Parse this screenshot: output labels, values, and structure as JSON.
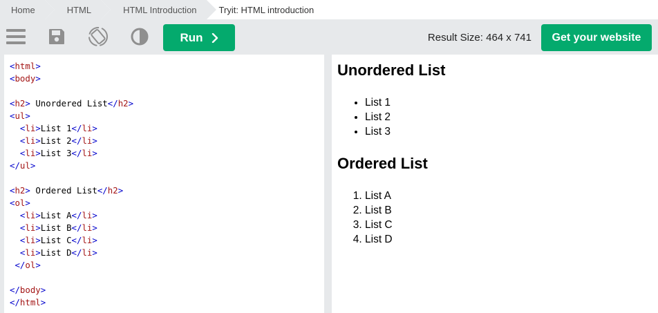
{
  "breadcrumb": [
    "Home",
    "HTML",
    "HTML Introduction",
    "Tryit: HTML introduction"
  ],
  "toolbar": {
    "icons": [
      "menu-icon",
      "save-icon",
      "rotate-icon",
      "contrast-icon"
    ],
    "run_label": "Run",
    "result_size": "Result Size: 464 x 741",
    "website_label": "Get your website"
  },
  "colors": {
    "accent": "#04aa6d",
    "toolbar_bg": "#e7e9eb"
  },
  "code": [
    {
      "segments": [
        [
          "ang",
          "<"
        ],
        [
          "tag",
          "html"
        ],
        [
          "ang",
          ">"
        ]
      ]
    },
    {
      "segments": [
        [
          "ang",
          "<"
        ],
        [
          "tag",
          "body"
        ],
        [
          "ang",
          ">"
        ]
      ]
    },
    {
      "segments": []
    },
    {
      "segments": [
        [
          "ang",
          "<"
        ],
        [
          "tag",
          "h2"
        ],
        [
          "ang",
          ">"
        ],
        [
          "txt",
          " Unordered List"
        ],
        [
          "ang",
          "</"
        ],
        [
          "tag",
          "h2"
        ],
        [
          "ang",
          ">"
        ]
      ]
    },
    {
      "segments": [
        [
          "ang",
          "<"
        ],
        [
          "tag",
          "ul"
        ],
        [
          "ang",
          ">"
        ]
      ]
    },
    {
      "segments": [
        [
          "txt",
          "  "
        ],
        [
          "ang",
          "<"
        ],
        [
          "tag",
          "li"
        ],
        [
          "ang",
          ">"
        ],
        [
          "txt",
          "List 1"
        ],
        [
          "ang",
          "</"
        ],
        [
          "tag",
          "li"
        ],
        [
          "ang",
          ">"
        ]
      ]
    },
    {
      "segments": [
        [
          "txt",
          "  "
        ],
        [
          "ang",
          "<"
        ],
        [
          "tag",
          "li"
        ],
        [
          "ang",
          ">"
        ],
        [
          "txt",
          "List 2"
        ],
        [
          "ang",
          "</"
        ],
        [
          "tag",
          "li"
        ],
        [
          "ang",
          ">"
        ]
      ]
    },
    {
      "segments": [
        [
          "txt",
          "  "
        ],
        [
          "ang",
          "<"
        ],
        [
          "tag",
          "li"
        ],
        [
          "ang",
          ">"
        ],
        [
          "txt",
          "List 3"
        ],
        [
          "ang",
          "</"
        ],
        [
          "tag",
          "li"
        ],
        [
          "ang",
          ">"
        ]
      ]
    },
    {
      "segments": [
        [
          "ang",
          "</"
        ],
        [
          "tag",
          "ul"
        ],
        [
          "ang",
          ">"
        ]
      ]
    },
    {
      "segments": []
    },
    {
      "segments": [
        [
          "ang",
          "<"
        ],
        [
          "tag",
          "h2"
        ],
        [
          "ang",
          ">"
        ],
        [
          "txt",
          " Ordered List"
        ],
        [
          "ang",
          "</"
        ],
        [
          "tag",
          "h2"
        ],
        [
          "ang",
          ">"
        ]
      ]
    },
    {
      "segments": [
        [
          "ang",
          "<"
        ],
        [
          "tag",
          "ol"
        ],
        [
          "ang",
          ">"
        ]
      ]
    },
    {
      "segments": [
        [
          "txt",
          "  "
        ],
        [
          "ang",
          "<"
        ],
        [
          "tag",
          "li"
        ],
        [
          "ang",
          ">"
        ],
        [
          "txt",
          "List A"
        ],
        [
          "ang",
          "</"
        ],
        [
          "tag",
          "li"
        ],
        [
          "ang",
          ">"
        ]
      ]
    },
    {
      "segments": [
        [
          "txt",
          "  "
        ],
        [
          "ang",
          "<"
        ],
        [
          "tag",
          "li"
        ],
        [
          "ang",
          ">"
        ],
        [
          "txt",
          "List B"
        ],
        [
          "ang",
          "</"
        ],
        [
          "tag",
          "li"
        ],
        [
          "ang",
          ">"
        ]
      ]
    },
    {
      "segments": [
        [
          "txt",
          "  "
        ],
        [
          "ang",
          "<"
        ],
        [
          "tag",
          "li"
        ],
        [
          "ang",
          ">"
        ],
        [
          "txt",
          "List C"
        ],
        [
          "ang",
          "</"
        ],
        [
          "tag",
          "li"
        ],
        [
          "ang",
          ">"
        ]
      ]
    },
    {
      "segments": [
        [
          "txt",
          "  "
        ],
        [
          "ang",
          "<"
        ],
        [
          "tag",
          "li"
        ],
        [
          "ang",
          ">"
        ],
        [
          "txt",
          "List D"
        ],
        [
          "ang",
          "</"
        ],
        [
          "tag",
          "li"
        ],
        [
          "ang",
          ">"
        ]
      ]
    },
    {
      "segments": [
        [
          "txt",
          " "
        ],
        [
          "ang",
          "</"
        ],
        [
          "tag",
          "ol"
        ],
        [
          "ang",
          ">"
        ]
      ]
    },
    {
      "segments": []
    },
    {
      "segments": [
        [
          "ang",
          "</"
        ],
        [
          "tag",
          "body"
        ],
        [
          "ang",
          ">"
        ]
      ]
    },
    {
      "segments": [
        [
          "ang",
          "</"
        ],
        [
          "tag",
          "html"
        ],
        [
          "ang",
          ">"
        ]
      ]
    }
  ],
  "result": {
    "unordered_heading": "Unordered List",
    "unordered_items": [
      "List 1",
      "List 2",
      "List 3"
    ],
    "ordered_heading": "Ordered List",
    "ordered_items": [
      "List A",
      "List B",
      "List C",
      "List D"
    ]
  }
}
